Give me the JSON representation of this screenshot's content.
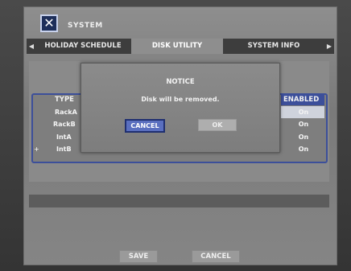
{
  "header": {
    "title": "SYSTEM",
    "logo_icon": "tools-icon"
  },
  "tabs": [
    {
      "label": "HOLIDAY SCHEDULE"
    },
    {
      "label": "DISK UTILITY"
    },
    {
      "label": "SYSTEM INFO"
    }
  ],
  "table": {
    "col_type": "TYPE",
    "col_enabled": "ENABLED",
    "rows": [
      {
        "type": "RackA",
        "enabled": "On"
      },
      {
        "type": "RackB",
        "enabled": "On"
      },
      {
        "type": "IntA",
        "enabled": "On"
      },
      {
        "type": "IntB",
        "enabled": "On"
      }
    ],
    "row_marker": "+"
  },
  "dialog": {
    "title": "NOTICE",
    "message": "Disk will be removed.",
    "cancel_label": "CANCEL",
    "ok_label": "OK"
  },
  "footer": {
    "save_label": "SAVE",
    "cancel_label": "CANCEL"
  },
  "colors": {
    "accent": "#3c4f9a",
    "panel": "#8a8a8a"
  }
}
